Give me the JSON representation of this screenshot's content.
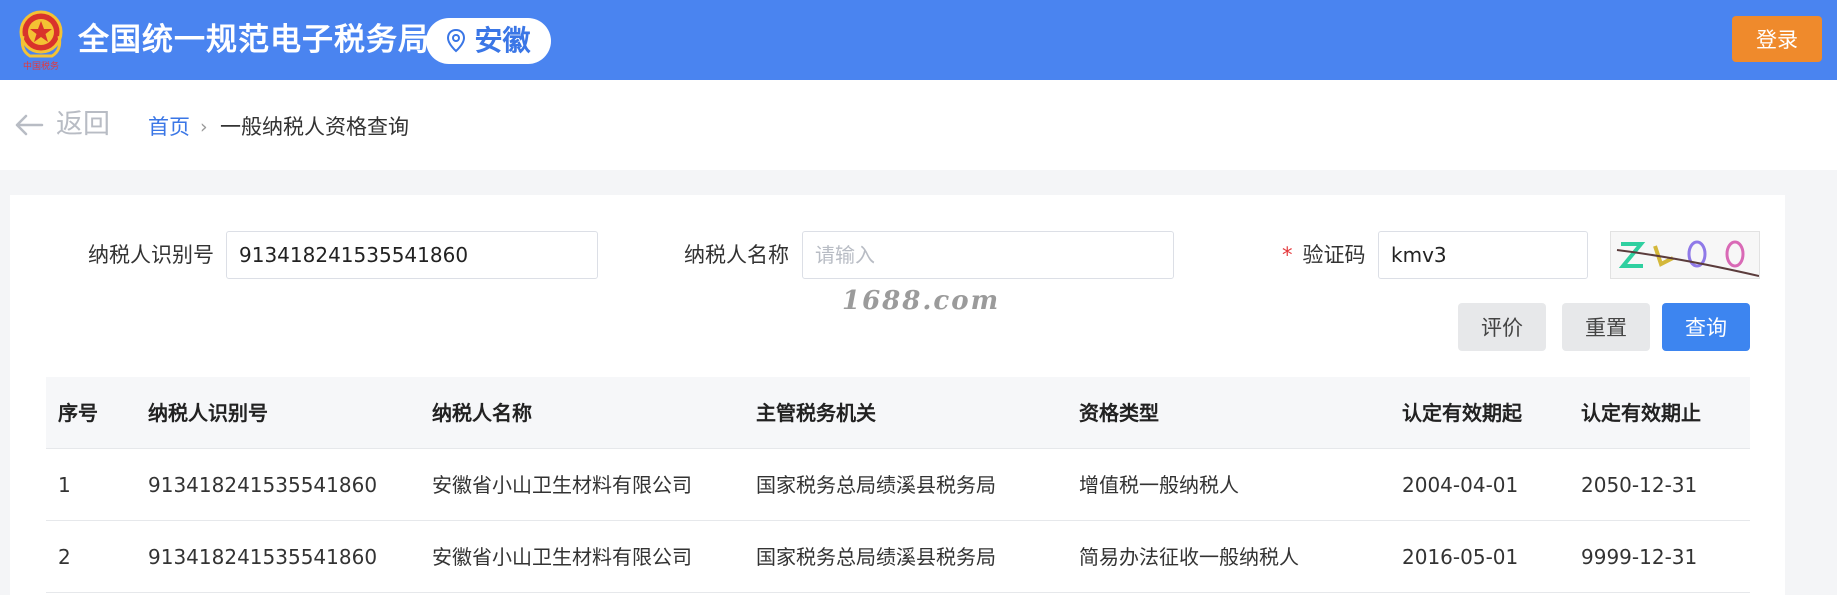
{
  "header": {
    "site_title": "全国统一规范电子税务局",
    "region": "安徽",
    "login_label": "登录",
    "emblem_label": "中国税务"
  },
  "breadcrumb": {
    "back_label": "返回",
    "home_label": "首页",
    "separator": "›",
    "current_label": "一般纳税人资格查询"
  },
  "form": {
    "taxpayer_id_label": "纳税人识别号",
    "taxpayer_id_value": "913418241535541860",
    "taxpayer_name_label": "纳税人名称",
    "taxpayer_name_placeholder": "请输入",
    "captcha_required_mark": "*",
    "captcha_label": "验证码",
    "captcha_value": "kmv3"
  },
  "watermark": "1688.com",
  "buttons": {
    "rate_label": "评价",
    "reset_label": "重置",
    "query_label": "查询"
  },
  "table": {
    "columns": [
      "序号",
      "纳税人识别号",
      "纳税人名称",
      "主管税务机关",
      "资格类型",
      "认定有效期起",
      "认定有效期止"
    ],
    "rows": [
      [
        "1",
        "913418241535541860",
        "安徽省小山卫生材料有限公司",
        "国家税务总局绩溪县税务局",
        "增值税一般纳税人",
        "2004-04-01",
        "2050-12-31"
      ],
      [
        "2",
        "913418241535541860",
        "安徽省小山卫生材料有限公司",
        "国家税务总局绩溪县税务局",
        "简易办法征收一般纳税人",
        "2016-05-01",
        "9999-12-31"
      ]
    ]
  },
  "colors": {
    "header_bg": "#4a84f0",
    "login_bg": "#ef8a2c",
    "primary": "#3d85f0",
    "link": "#3a76e6"
  },
  "icons": [
    "tax-emblem-icon",
    "location-pin-icon",
    "back-arrow-icon",
    "captcha-image"
  ]
}
